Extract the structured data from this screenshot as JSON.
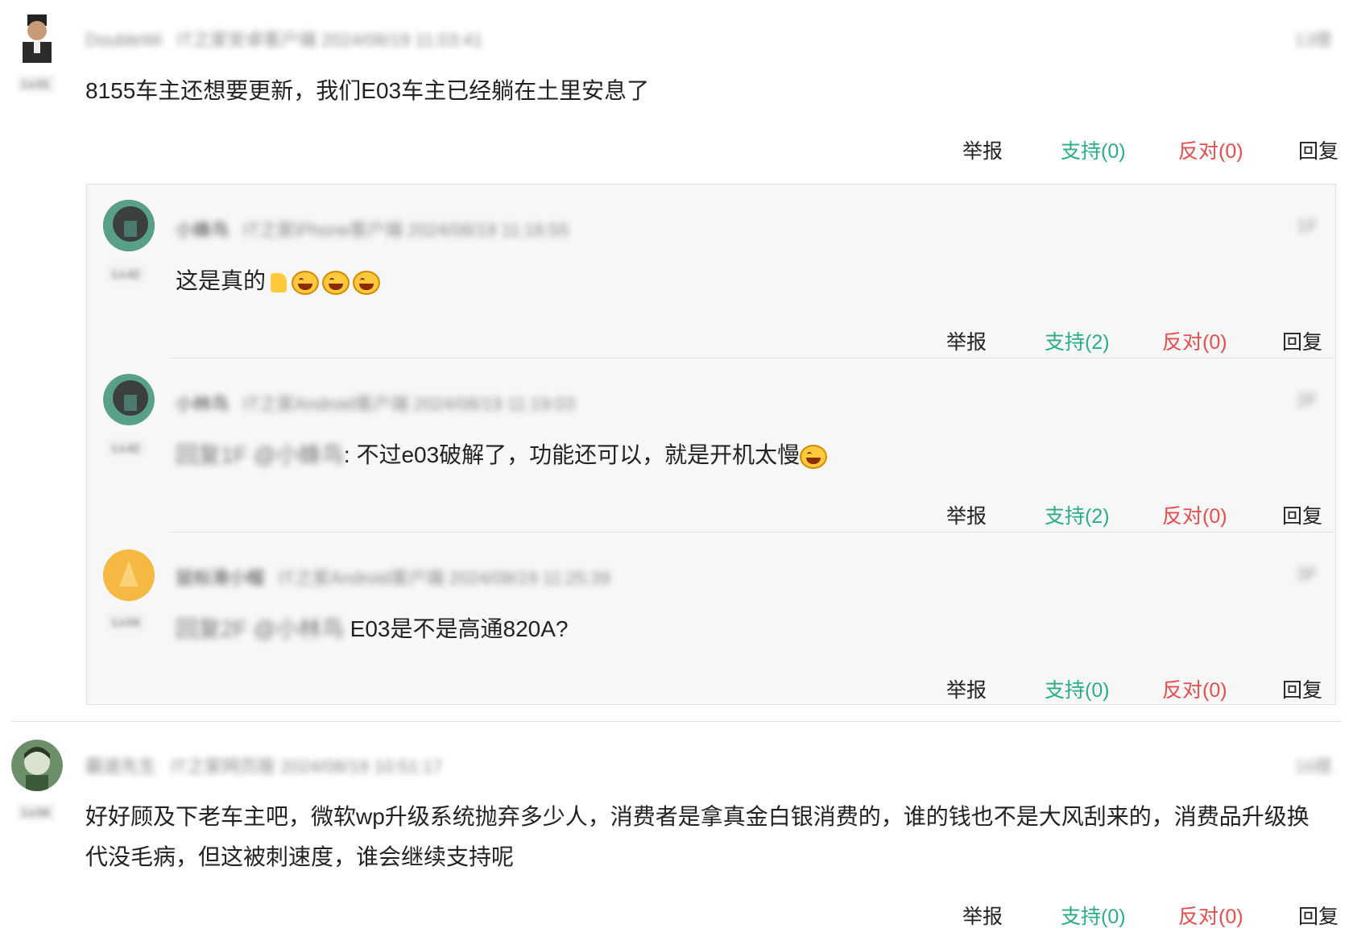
{
  "comments": [
    {
      "username": "DoubleWi",
      "meta": "IT之家安卓客户端 2024/08/19 11:03:41",
      "floor": "13楼",
      "level": "Lv.01",
      "text": "8155车主还想要更新，我们E03车主已经躺在土里安息了",
      "actions": {
        "report": "举报",
        "support": "支持(0)",
        "oppose": "反对(0)",
        "reply": "回复"
      }
    },
    {
      "username": "霸道先生",
      "meta": "IT之家网页版 2024/08/19 10:51:17",
      "floor": "16楼",
      "level": "Lv.04",
      "text_line1": "好好顾及下老车主吧，微软wp升级系统抛弃多少人，消费者是拿真金白银消费的，谁的钱也不是大风刮来的，消费品升级换",
      "text_line2": "代没毛病，但这被刺速度，谁会继续支持呢",
      "actions": {
        "report": "举报",
        "support": "支持(0)",
        "oppose": "反对(0)",
        "reply": "回复"
      }
    }
  ],
  "replies": [
    {
      "username": "小蜂鸟",
      "meta": "IT之家iPhone客户端 2024/08/19 11:16:55",
      "floor": "1F",
      "level": "Lv.42",
      "text": "这是真的",
      "actions": {
        "report": "举报",
        "support": "支持(2)",
        "oppose": "反对(0)",
        "reply": "回复"
      }
    },
    {
      "username": "小林鸟",
      "meta": "IT之家Android客户端 2024/08/19 11:19:03",
      "floor": "2F",
      "level": "Lv.42",
      "quote": "回复1F @小蜂鸟",
      "text": ": 不过e03破解了，功能还可以，就是开机太慢",
      "actions": {
        "report": "举报",
        "support": "支持(2)",
        "oppose": "反对(0)",
        "reply": "回复"
      }
    },
    {
      "username": "鼠标滑小帽",
      "meta": "IT之家Android客户端 2024/08/19 11:25:39",
      "floor": "3F",
      "level": "Lv.04",
      "quote": "回复2F @小林鸟",
      "text": "E03是不是高通820A?",
      "actions": {
        "report": "举报",
        "support": "支持(0)",
        "oppose": "反对(0)",
        "reply": "回复"
      }
    }
  ],
  "colors": {
    "support": "#2bae85",
    "oppose": "#e84c4c",
    "box_bg": "#f7f7f7"
  }
}
